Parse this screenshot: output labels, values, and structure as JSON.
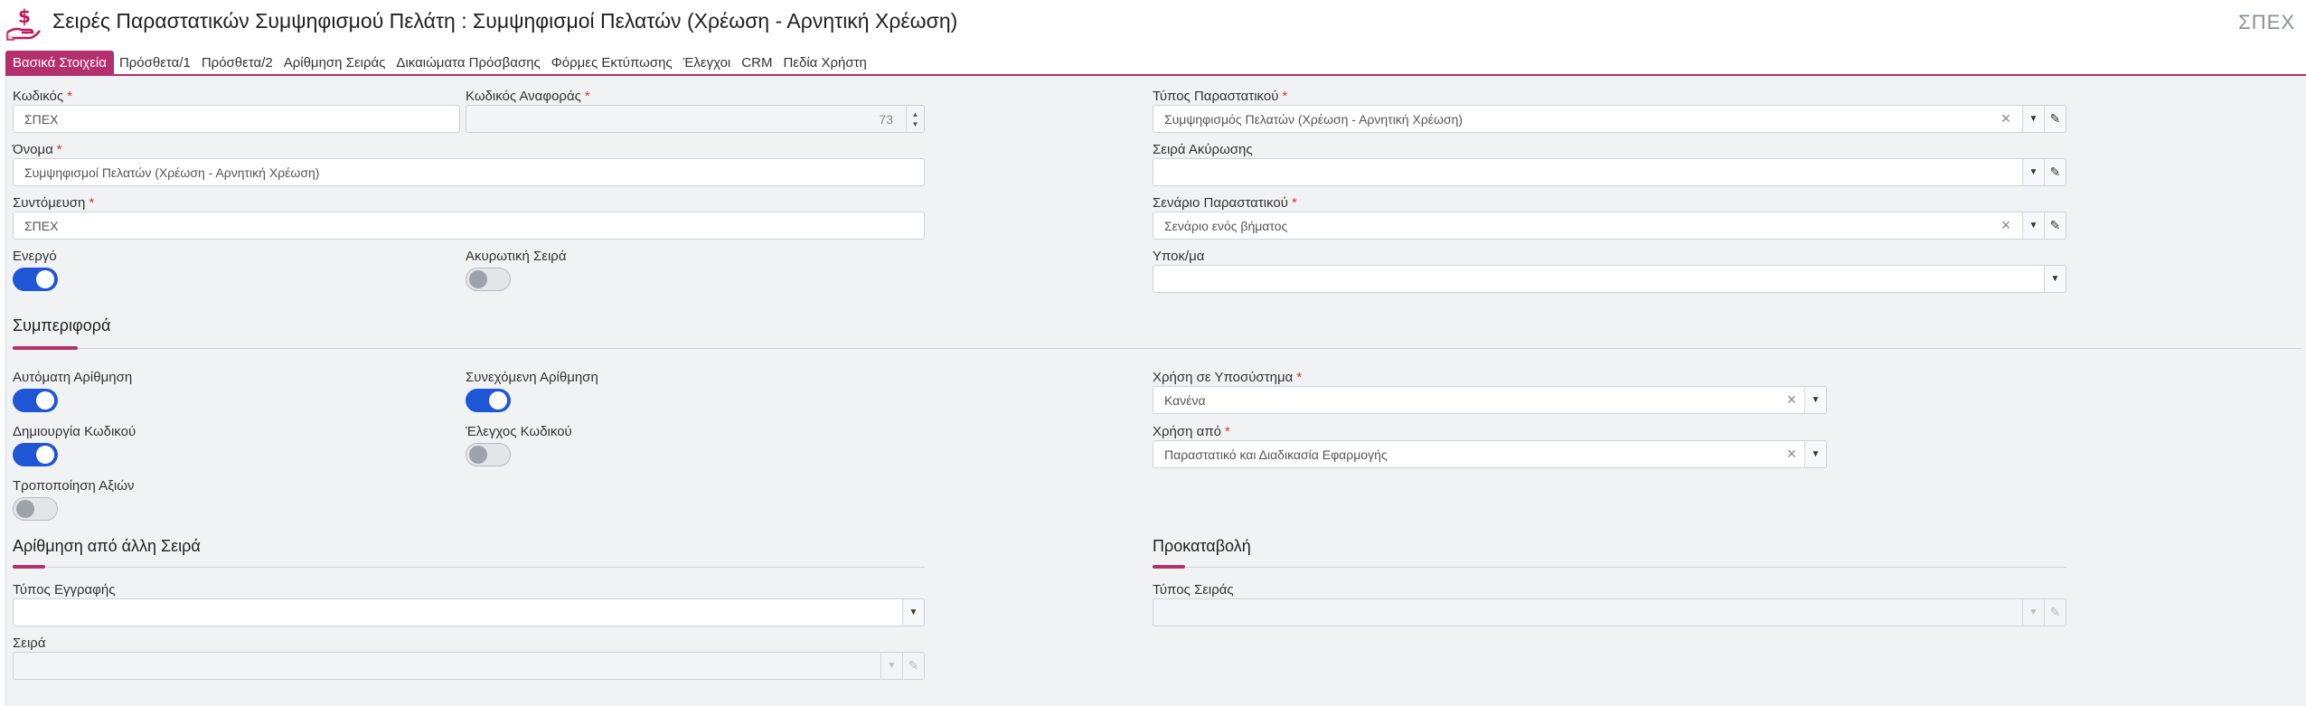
{
  "header": {
    "title": "Σειρές Παραστατικών Συμψηφισμού Πελάτη : Συμψηφισμοί Πελατών (Χρέωση - Αρνητική Χρέωση)",
    "code": "ΣΠΕΧ",
    "icon": "hand-money-icon",
    "icon_color": "#c2185b"
  },
  "tabs": [
    {
      "label": "Βασικά Στοιχεία",
      "active": true
    },
    {
      "label": "Πρόσθετα/1"
    },
    {
      "label": "Πρόσθετα/2"
    },
    {
      "label": "Αρίθμηση Σειράς"
    },
    {
      "label": "Δικαιώματα Πρόσβασης"
    },
    {
      "label": "Φόρμες Εκτύπωσης"
    },
    {
      "label": "Έλεγχοι"
    },
    {
      "label": "CRM"
    },
    {
      "label": "Πεδία Χρήστη"
    }
  ],
  "accent_color": "#b4306d",
  "toggle_on_color": "#1f56d6",
  "fields": {
    "code": {
      "label": "Κωδικός",
      "value": "ΣΠΕΧ"
    },
    "ref_code": {
      "label": "Κωδικός Αναφοράς",
      "value": "73"
    },
    "doc_type": {
      "label": "Τύπος Παραστατικού",
      "value": "Συμψηφισμός Πελατών (Χρέωση - Αρνητική Χρέωση)"
    },
    "name": {
      "label": "Όνομα",
      "value": "Συμψηφισμοί Πελατών (Χρέωση - Αρνητική Χρέωση)"
    },
    "cancel_series": {
      "label": "Σειρά Ακύρωσης",
      "value": ""
    },
    "short": {
      "label": "Συντόμευση",
      "value": "ΣΠΕΧ"
    },
    "doc_scenario": {
      "label": "Σενάριο Παραστατικού",
      "value": "Σενάριο ενός βήματος"
    },
    "active": {
      "label": "Ενεργό",
      "on": true
    },
    "cancelling_series": {
      "label": "Ακυρωτική Σειρά",
      "on": false
    },
    "branch": {
      "label": "Υποκ/μα",
      "value": ""
    }
  },
  "behavior": {
    "title": "Συμπεριφορά",
    "auto_numbering": {
      "label": "Αυτόματη Αρίθμηση",
      "on": true
    },
    "continuous_numbering": {
      "label": "Συνεχόμενη Αρίθμηση",
      "on": true
    },
    "code_creation": {
      "label": "Δημιουργία Κωδικού",
      "on": true
    },
    "code_check": {
      "label": "Έλεγχος Κωδικού",
      "on": false
    },
    "value_modification": {
      "label": "Τροποποίηση Αξιών",
      "on": false
    },
    "subsystem_use": {
      "label": "Χρήση σε Υποσύστημα",
      "value": "Κανένα"
    },
    "used_by": {
      "label": "Χρήση από",
      "value": "Παραστατικό και Διαδικασία Εφαρμογής"
    }
  },
  "other_numbering": {
    "title": "Αρίθμηση από άλλη Σειρά",
    "record_type": {
      "label": "Τύπος Εγγραφής",
      "value": ""
    },
    "series": {
      "label": "Σειρά",
      "value": ""
    }
  },
  "advance": {
    "title": "Προκαταβολή",
    "series_type": {
      "label": "Τύπος Σειράς",
      "value": ""
    }
  }
}
